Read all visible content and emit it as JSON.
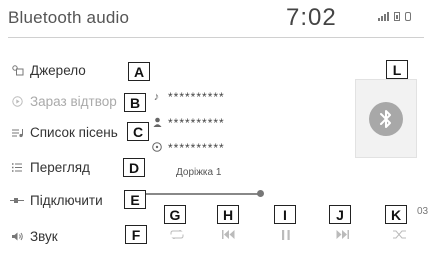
{
  "header": {
    "title": "Bluetooth audio",
    "time": "7:02"
  },
  "menu": [
    {
      "label": "Джерело",
      "icon": "source-icon"
    },
    {
      "label": "Зараз відтвор",
      "icon": "now-playing-icon"
    },
    {
      "label": "Список пісень",
      "icon": "song-list-icon"
    },
    {
      "label": "Перегляд",
      "icon": "browse-icon"
    },
    {
      "label": "Підключити",
      "icon": "connect-icon"
    },
    {
      "label": "Звук",
      "icon": "sound-icon"
    }
  ],
  "callouts": {
    "a": "A",
    "b": "B",
    "c": "C",
    "d": "D",
    "e": "E",
    "f": "F",
    "g": "G",
    "h": "H",
    "i": "I",
    "j": "J",
    "k": "K",
    "l": "L"
  },
  "track": {
    "title": "**********",
    "artist": "**********",
    "album": "**********",
    "number": "Доріжка 1",
    "time_fragment": "03"
  },
  "progress_fraction": 0.97,
  "colors": {
    "text": "#333333",
    "dim": "#aaaaaa",
    "art_bg": "#f2f2f2",
    "bt_circle": "#a8a8a8"
  }
}
